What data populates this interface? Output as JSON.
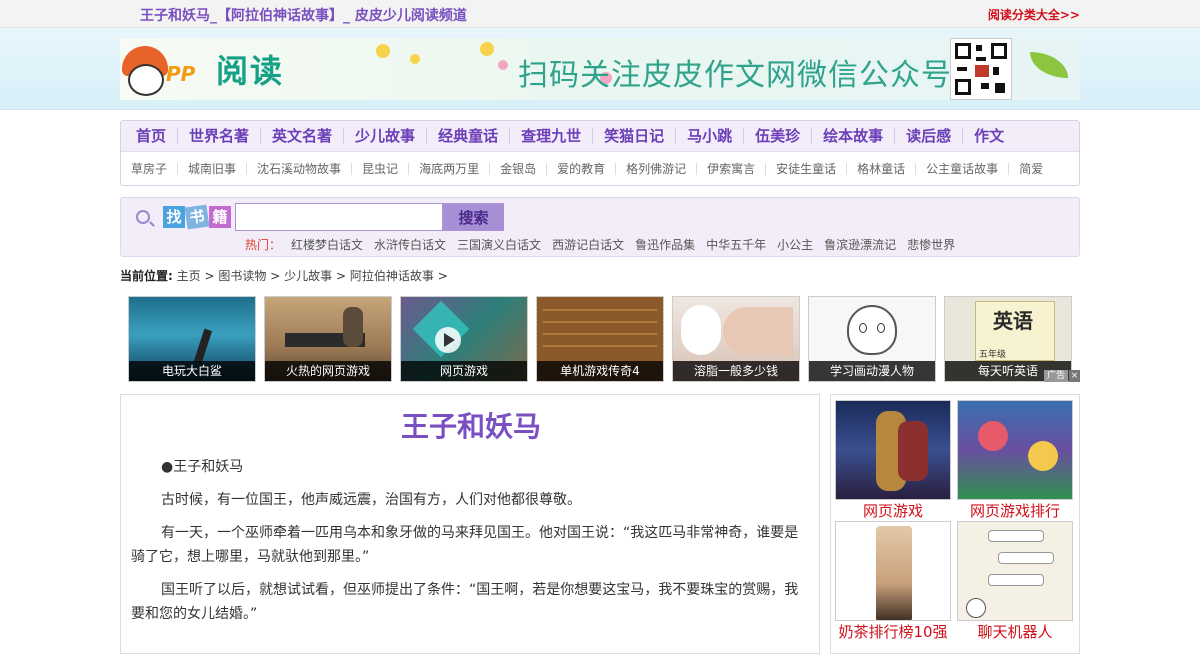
{
  "topbar": {
    "site_title": "王子和妖马_【阿拉伯神话故事】_ 皮皮少儿阅读频道",
    "category_link": "阅读分类大全>>"
  },
  "banner": {
    "logo_pp": "PP",
    "logo_text": "阅读",
    "slogan": "扫码关注皮皮作文网微信公众号"
  },
  "nav": {
    "main": [
      "首页",
      "世界名著",
      "英文名著",
      "少儿故事",
      "经典童话",
      "查理九世",
      "笑猫日记",
      "马小跳",
      "伍美珍",
      "绘本故事",
      "读后感",
      "作文"
    ],
    "sub": [
      "草房子",
      "城南旧事",
      "沈石溪动物故事",
      "昆虫记",
      "海底两万里",
      "金银岛",
      "爱的教育",
      "格列佛游记",
      "伊索寓言",
      "安徒生童话",
      "格林童话",
      "公主童话故事",
      "简爱"
    ]
  },
  "search": {
    "brand_chars": [
      "找",
      "书",
      "籍"
    ],
    "input_value": "",
    "button_label": "搜索",
    "hot_label": "热门：",
    "hot_links": [
      "红楼梦白话文",
      "水浒传白话文",
      "三国演义白话文",
      "西游记白话文",
      "鲁迅作品集",
      "中华五千年",
      "小公主",
      "鲁滨逊漂流记",
      "悲惨世界"
    ]
  },
  "breadcrumb": {
    "label": "当前位置:",
    "items": [
      "主页",
      "图书读物",
      "少儿故事",
      "阿拉伯神话故事"
    ],
    "sep": ">"
  },
  "thumbs": {
    "items": [
      {
        "caption": "电玩大白鲨"
      },
      {
        "caption": "火热的网页游戏"
      },
      {
        "caption": "网页游戏"
      },
      {
        "caption": "单机游戏传奇4"
      },
      {
        "caption": "溶脂一般多少钱"
      },
      {
        "caption": "学习画动漫人物"
      },
      {
        "caption": "每天听英语"
      }
    ],
    "ad_tag": "广告",
    "ad_close": "×",
    "english_book_text": "英语",
    "english_book_grade": "五年级"
  },
  "article": {
    "title": "王子和妖马",
    "paragraphs": [
      "●王子和妖马",
      "古时候，有一位国王，他声威远震，治国有方，人们对他都很尊敬。",
      "有一天，一个巫师牵着一匹用乌本和象牙做的马来拜见国王。他对国王说：“我这匹马非常神奇，谁要是骑了它，想上哪里，马就驮他到那里。”",
      "国王听了以后，就想试试看，但巫师提出了条件：“国王啊，若是你想要这宝马，我不要珠宝的赏赐，我要和您的女儿结婚。”"
    ]
  },
  "side_ads": {
    "items": [
      {
        "caption": "网页游戏"
      },
      {
        "caption": "网页游戏排行"
      },
      {
        "caption": "奶茶排行榜10强"
      },
      {
        "caption": "聊天机器人"
      }
    ]
  },
  "colors": {
    "brand_purple": "#7a4fc0",
    "alert_red": "#d0101a",
    "banner_green": "#2fa38c"
  }
}
